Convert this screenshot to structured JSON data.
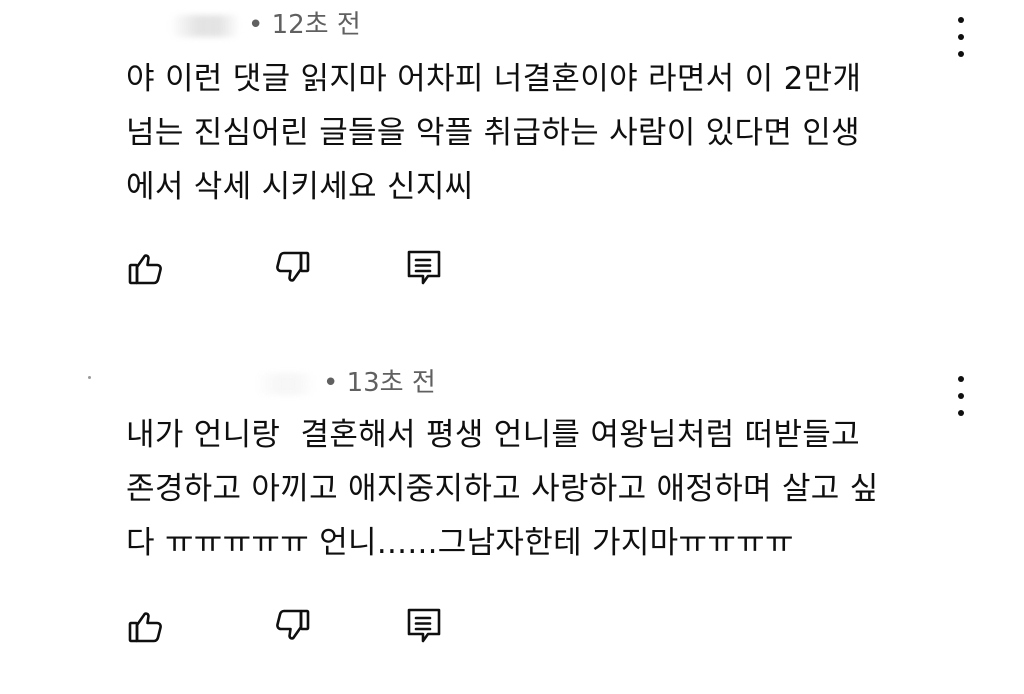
{
  "comments": [
    {
      "time": "• 12초 전",
      "text": "야 이런 댓글 읽지마 어차피 너결혼이야 라면서 이 2만개\n넘는 진심어린 글들을 악플 취급하는 사람이 있다면 인생\n에서 삭세 시키세요 신지씨",
      "icons": {
        "like": "thumbs-up-icon",
        "dislike": "thumbs-down-icon",
        "reply": "comment-reply-icon",
        "menu": "more-vert-icon"
      }
    },
    {
      "time": "• 13초 전",
      "text": "내가 언니랑  결혼해서 평생 언니를 여왕님처럼 떠받들고\n존경하고 아끼고 애지중지하고 사랑하고 애정하며 살고 싶\n다 ㅠㅠㅠㅠㅠ 언니......그남자한테 가지마ㅠㅠㅠㅠ",
      "icons": {
        "like": "thumbs-up-icon",
        "dislike": "thumbs-down-icon",
        "reply": "comment-reply-icon",
        "menu": "more-vert-icon"
      }
    }
  ]
}
